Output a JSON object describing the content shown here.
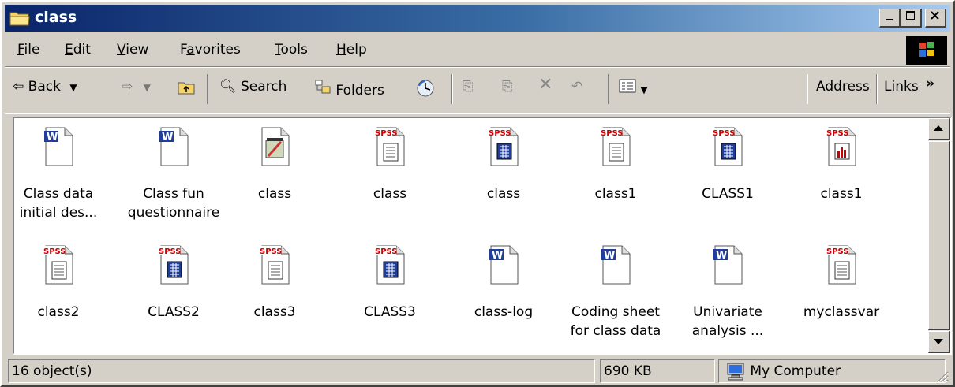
{
  "window": {
    "title": "class"
  },
  "menu": [
    {
      "label": "File",
      "underline": "F",
      "rest": "ile"
    },
    {
      "label": "Edit",
      "underline": "E",
      "rest": "dit"
    },
    {
      "label": "View",
      "underline": "V",
      "rest": "iew"
    },
    {
      "label": "Favorites",
      "underline": "a",
      "pre": "F",
      "rest": "vorites"
    },
    {
      "label": "Tools",
      "underline": "T",
      "rest": "ools"
    },
    {
      "label": "Help",
      "underline": "H",
      "rest": "elp"
    }
  ],
  "toolbar": {
    "back_label": "Back",
    "search_label": "Search",
    "folders_label": "Folders",
    "address_label": "Address",
    "links_label": "Links",
    "more_label": "»"
  },
  "files": [
    {
      "name": "Class data initial des...",
      "line1": "Class data",
      "line2": "initial des...",
      "icon": "word-doc-icon"
    },
    {
      "name": "Class fun questionnaire",
      "line1": "Class fun",
      "line2": "questionnaire",
      "icon": "word-doc-icon"
    },
    {
      "name": "class",
      "line1": "class",
      "line2": "",
      "icon": "notepad-file-icon"
    },
    {
      "name": "class",
      "line1": "class",
      "line2": "",
      "icon": "spss-syntax-icon"
    },
    {
      "name": "class",
      "line1": "class",
      "line2": "",
      "icon": "spss-data-icon"
    },
    {
      "name": "class1",
      "line1": "class1",
      "line2": "",
      "icon": "spss-syntax-icon"
    },
    {
      "name": "CLASS1",
      "line1": "CLASS1",
      "line2": "",
      "icon": "spss-data-icon"
    },
    {
      "name": "class1",
      "line1": "class1",
      "line2": "",
      "icon": "spss-output-icon"
    },
    {
      "name": "class2",
      "line1": "class2",
      "line2": "",
      "icon": "spss-syntax-icon"
    },
    {
      "name": "CLASS2",
      "line1": "CLASS2",
      "line2": "",
      "icon": "spss-data-icon"
    },
    {
      "name": "class3",
      "line1": "class3",
      "line2": "",
      "icon": "spss-syntax-icon"
    },
    {
      "name": "CLASS3",
      "line1": "CLASS3",
      "line2": "",
      "icon": "spss-data-icon"
    },
    {
      "name": "class-log",
      "line1": "class-log",
      "line2": "",
      "icon": "word-doc-icon"
    },
    {
      "name": "Coding sheet for class data",
      "line1": "Coding sheet",
      "line2": "for class data",
      "icon": "word-doc-icon"
    },
    {
      "name": "Univariate analysis ...",
      "line1": "Univariate",
      "line2": "analysis ...",
      "icon": "word-doc-icon"
    },
    {
      "name": "myclassvar",
      "line1": "myclassvar",
      "line2": "",
      "icon": "spss-syntax-icon"
    }
  ],
  "status": {
    "count": "16 object(s)",
    "size": "690 KB",
    "location": "My Computer"
  },
  "colors": {
    "title_start": "#0a246a",
    "title_end": "#a6caf0",
    "spss_red": "#cc0000",
    "word_blue": "#1f3d99"
  }
}
